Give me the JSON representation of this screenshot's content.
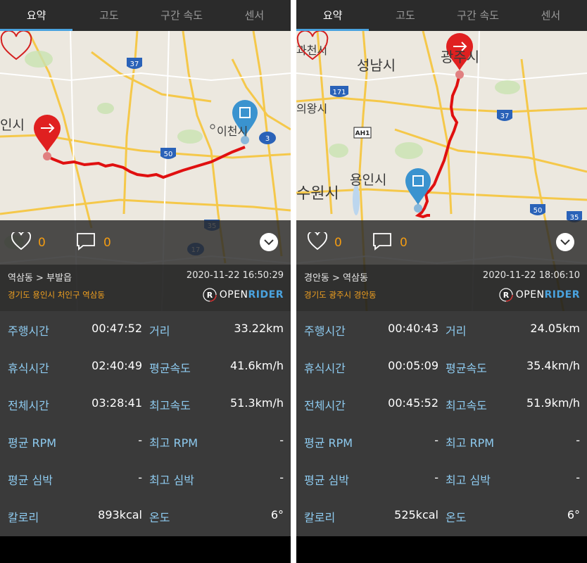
{
  "tabs": [
    "요약",
    "고도",
    "구간 속도",
    "센서"
  ],
  "brand": {
    "open": "OPEN",
    "rider": "RIDER"
  },
  "left": {
    "likes": "0",
    "comments": "0",
    "route_title": "역삼동 > 부발읍",
    "date": "2020-11-22 16:50:29",
    "address": "경기도 용인시 처인구 역삼동",
    "map_labels": {
      "city1": "인시",
      "city2": "이천시",
      "shield_37": "37",
      "shield_50": "50",
      "shield_3": "3",
      "shield_35": "35",
      "shield_17": "17"
    },
    "stats": [
      {
        "label": "주행시간",
        "value": "00:47:52",
        "label2": "거리",
        "value2": "33.22km"
      },
      {
        "label": "휴식시간",
        "value": "02:40:49",
        "label2": "평균속도",
        "value2": "41.6km/h"
      },
      {
        "label": "전체시간",
        "value": "03:28:41",
        "label2": "최고속도",
        "value2": "51.3km/h"
      },
      {
        "label": "평균 RPM",
        "value": "-",
        "label2": "최고 RPM",
        "value2": "-"
      },
      {
        "label": "평균 심박",
        "value": "-",
        "label2": "최고 심박",
        "value2": "-"
      },
      {
        "label": "칼로리",
        "value": "893kcal",
        "label2": "온도",
        "value2": "6°"
      }
    ]
  },
  "right": {
    "likes": "0",
    "comments": "0",
    "route_title": "경안동 > 역삼동",
    "date": "2020-11-22 18:06:10",
    "address": "경기도 광주시 경안동",
    "map_labels": {
      "city1": "성남시",
      "city2": "용인시",
      "city3": "수원시",
      "city4": "의왕시",
      "city5": "과천시",
      "city6": "광주시",
      "shield_171": "171",
      "shield_ah1": "AH1",
      "shield_37": "37",
      "shield_50": "50",
      "shield_35": "35"
    },
    "stats": [
      {
        "label": "주행시간",
        "value": "00:40:43",
        "label2": "거리",
        "value2": "24.05km"
      },
      {
        "label": "휴식시간",
        "value": "00:05:09",
        "label2": "평균속도",
        "value2": "35.4km/h"
      },
      {
        "label": "전체시간",
        "value": "00:45:52",
        "label2": "최고속도",
        "value2": "51.9km/h"
      },
      {
        "label": "평균 RPM",
        "value": "-",
        "label2": "최고 RPM",
        "value2": "-"
      },
      {
        "label": "평균 심박",
        "value": "-",
        "label2": "최고 심박",
        "value2": "-"
      },
      {
        "label": "칼로리",
        "value": "525kcal",
        "label2": "온도",
        "value2": "6°"
      }
    ]
  },
  "colors": {
    "accent": "#4aa3df",
    "count": "#f39c12",
    "route": "#e01010",
    "start_pin": "#e02020",
    "end_pin": "#3a93cf",
    "label": "#8ecbf0"
  }
}
